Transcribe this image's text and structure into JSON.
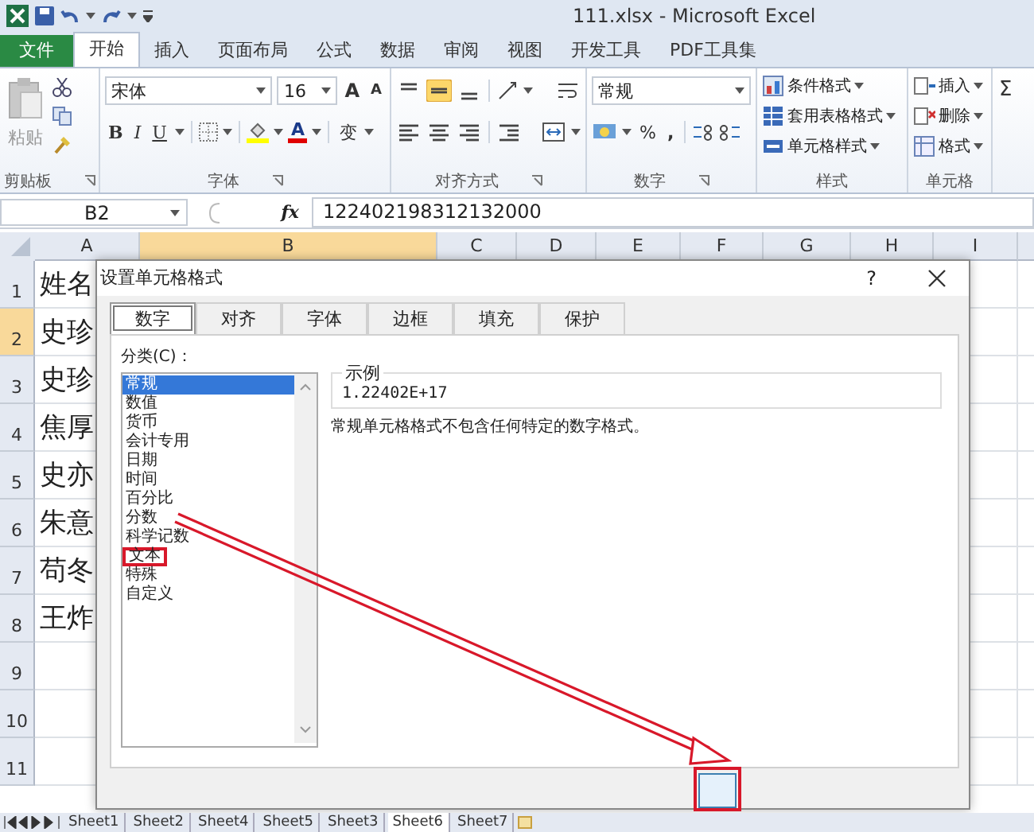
{
  "window": {
    "title": "111.xlsx - Microsoft Excel"
  },
  "ribbon_tabs": [
    {
      "label": "文件",
      "kind": "file",
      "selected": false
    },
    {
      "label": "开始",
      "kind": "tab",
      "selected": true
    },
    {
      "label": "插入",
      "kind": "tab",
      "selected": false
    },
    {
      "label": "页面布局",
      "kind": "tab",
      "selected": false
    },
    {
      "label": "公式",
      "kind": "tab",
      "selected": false
    },
    {
      "label": "数据",
      "kind": "tab",
      "selected": false
    },
    {
      "label": "审阅",
      "kind": "tab",
      "selected": false
    },
    {
      "label": "视图",
      "kind": "tab",
      "selected": false
    },
    {
      "label": "开发工具",
      "kind": "tab",
      "selected": false
    },
    {
      "label": "PDF工具集",
      "kind": "tab",
      "selected": false
    }
  ],
  "ribbon": {
    "clipboard": {
      "paste": "粘贴",
      "group_label": "剪贴板"
    },
    "font": {
      "name": "宋体",
      "size": "16",
      "grow": "A",
      "shrink": "A",
      "bold": "B",
      "italic": "I",
      "underline": "U",
      "font_color": "A",
      "phonetic": "变",
      "group_label": "字体"
    },
    "alignment": {
      "group_label": "对齐方式"
    },
    "number": {
      "format": "常规",
      "percent": "%",
      "comma": ",",
      "group_label": "数字"
    },
    "styles": {
      "items": [
        "条件格式",
        "套用表格格式",
        "单元格样式"
      ],
      "group_label": "样式"
    },
    "cells": {
      "items": [
        "插入",
        "删除",
        "格式"
      ],
      "group_label": "单元格"
    },
    "editing": {
      "sum": "Σ"
    }
  },
  "formula_bar": {
    "name_box": "B2",
    "function_label": "fx",
    "value": "122402198312132000"
  },
  "columns": [
    {
      "label": "A",
      "selected": false
    },
    {
      "label": "B",
      "selected": true
    },
    {
      "label": "C",
      "selected": false
    },
    {
      "label": "D",
      "selected": false
    },
    {
      "label": "E",
      "selected": false
    },
    {
      "label": "F",
      "selected": false
    },
    {
      "label": "G",
      "selected": false
    },
    {
      "label": "H",
      "selected": false
    },
    {
      "label": "I",
      "selected": false
    }
  ],
  "rows": [
    {
      "number": "1",
      "selected": false,
      "cell_a": "姓名"
    },
    {
      "number": "2",
      "selected": true,
      "cell_a": "史珍"
    },
    {
      "number": "3",
      "selected": false,
      "cell_a": "史珍"
    },
    {
      "number": "4",
      "selected": false,
      "cell_a": "焦厚"
    },
    {
      "number": "5",
      "selected": false,
      "cell_a": "史亦"
    },
    {
      "number": "6",
      "selected": false,
      "cell_a": "朱意"
    },
    {
      "number": "7",
      "selected": false,
      "cell_a": "苟冬"
    },
    {
      "number": "8",
      "selected": false,
      "cell_a": "王炸"
    },
    {
      "number": "9",
      "selected": false
    },
    {
      "number": "10",
      "selected": false
    },
    {
      "number": "11",
      "selected": false
    }
  ],
  "dialog": {
    "title": "设置单元格格式",
    "help": "?",
    "tabs": [
      {
        "label": "数字",
        "selected": true
      },
      {
        "label": "对齐",
        "selected": false
      },
      {
        "label": "字体",
        "selected": false
      },
      {
        "label": "边框",
        "selected": false
      },
      {
        "label": "填充",
        "selected": false
      },
      {
        "label": "保护",
        "selected": false
      }
    ],
    "category_label": "分类(C)：",
    "categories": [
      {
        "label": "常规",
        "selected": true,
        "annotated": false
      },
      {
        "label": "数值",
        "selected": false,
        "annotated": false
      },
      {
        "label": "货币",
        "selected": false,
        "annotated": false
      },
      {
        "label": "会计专用",
        "selected": false,
        "annotated": false
      },
      {
        "label": "日期",
        "selected": false,
        "annotated": false
      },
      {
        "label": "时间",
        "selected": false,
        "annotated": false
      },
      {
        "label": "百分比",
        "selected": false,
        "annotated": false
      },
      {
        "label": "分数",
        "selected": false,
        "annotated": false
      },
      {
        "label": "科学记数",
        "selected": false,
        "annotated": false
      },
      {
        "label": "文本",
        "selected": false,
        "annotated": true
      },
      {
        "label": "特殊",
        "selected": false,
        "annotated": false
      },
      {
        "label": "自定义",
        "selected": false,
        "annotated": false
      }
    ],
    "sample_label": "示例",
    "sample_value": "1.22402E+17",
    "description": "常规单元格格式不包含任何特定的数字格式。"
  },
  "sheet_tabs": [
    {
      "label": "Sheet1",
      "selected": false
    },
    {
      "label": "Sheet2",
      "selected": false
    },
    {
      "label": "Sheet4",
      "selected": false
    },
    {
      "label": "Sheet5",
      "selected": false
    },
    {
      "label": "Sheet3",
      "selected": false
    },
    {
      "label": "Sheet6",
      "selected": true
    },
    {
      "label": "Sheet7",
      "selected": false
    }
  ]
}
